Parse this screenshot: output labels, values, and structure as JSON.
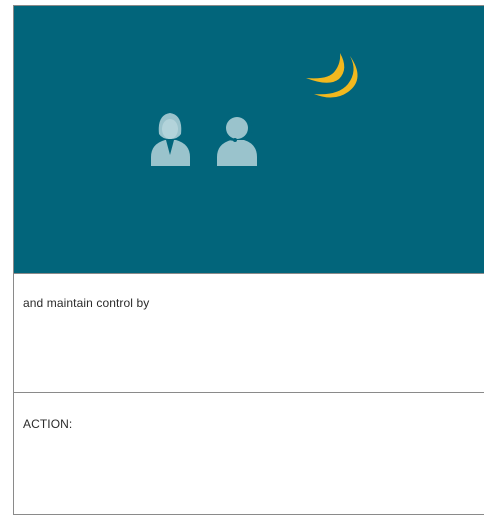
{
  "scene": {
    "background_color": "#02657b",
    "figure_color": "#9ac3cc",
    "moon_color": "#f2b81e",
    "icons": [
      "woman-user-icon",
      "headset-agent-icon",
      "crescent-moon-icon"
    ]
  },
  "panels": [
    {
      "text": "and maintain control by"
    },
    {
      "text": "ACTION:"
    }
  ]
}
